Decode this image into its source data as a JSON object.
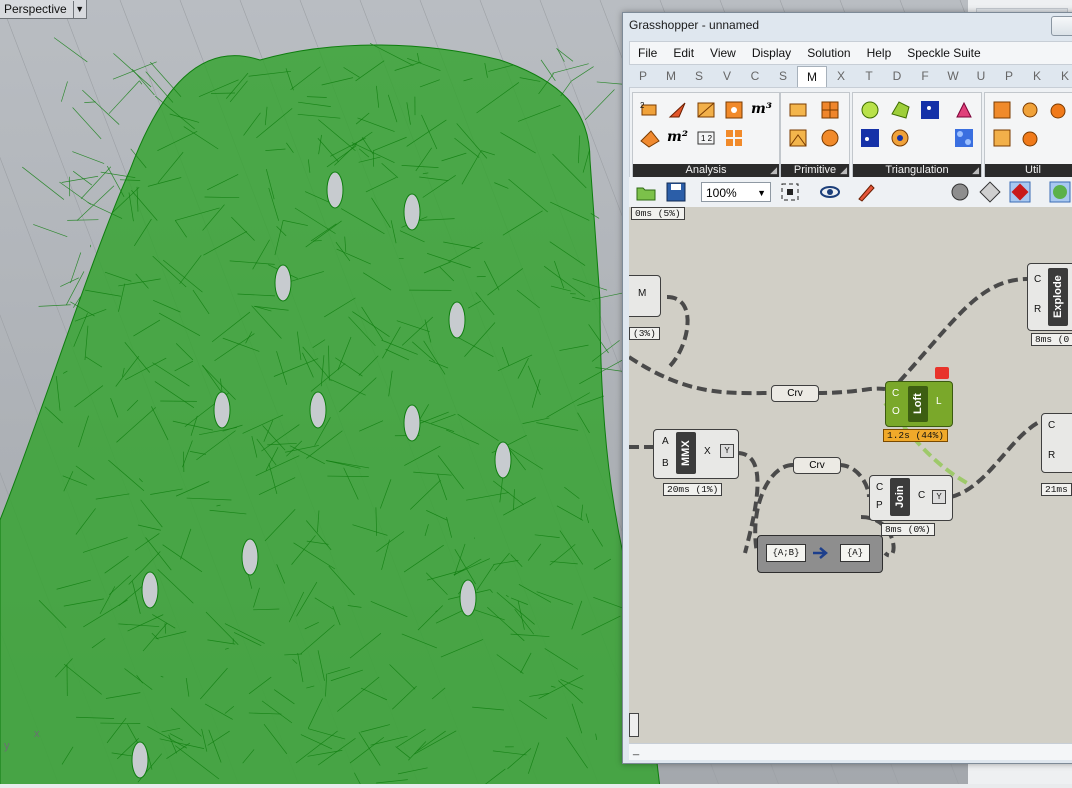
{
  "viewport": {
    "label": "Perspective",
    "dropdown_glyph": "▼",
    "axis_y": "y",
    "axis_x": "x",
    "mesh_color": "#2fa32a",
    "mesh_line_color": "#0e7d0e"
  },
  "grasshopper": {
    "title": "Grasshopper - unnamed",
    "menu": [
      "File",
      "Edit",
      "View",
      "Display",
      "Solution",
      "Help",
      "Speckle Suite"
    ],
    "tabs": [
      "P",
      "M",
      "S",
      "V",
      "C",
      "S",
      "M",
      "X",
      "T",
      "D",
      "F",
      "W",
      "U",
      "P",
      "K",
      "K"
    ],
    "active_tab": "M",
    "ribbon_panels": [
      "Analysis",
      "Primitive",
      "Triangulation",
      "Util"
    ],
    "zoom": "100%",
    "status_text": "_"
  },
  "canvas": {
    "top_timing": "0ms (5%)",
    "m_component": {
      "input": "M",
      "timing": "(3%)"
    },
    "explode": {
      "nickname": "Explode",
      "in1": "C",
      "in2": "R",
      "timing": "8ms (0"
    },
    "crv1": "Crv",
    "crv2": "Crv",
    "loft": {
      "nickname": "Loft",
      "in1": "C",
      "in2": "O",
      "out": "L",
      "timing": "1.2s (44%)",
      "color": "#7aa82a"
    },
    "mmx": {
      "nickname": "MMX",
      "in1": "A",
      "in2": "B",
      "out": "X",
      "timing": "20ms (1%)"
    },
    "join": {
      "nickname": "Join",
      "in1": "C",
      "in2": "P",
      "out": "C",
      "timing": "8ms (0%)"
    },
    "right_comp": {
      "in1": "C",
      "in2": "R",
      "timing": "21ms"
    },
    "path_mapper": {
      "from": "{A;B}",
      "to": "{A}"
    }
  }
}
